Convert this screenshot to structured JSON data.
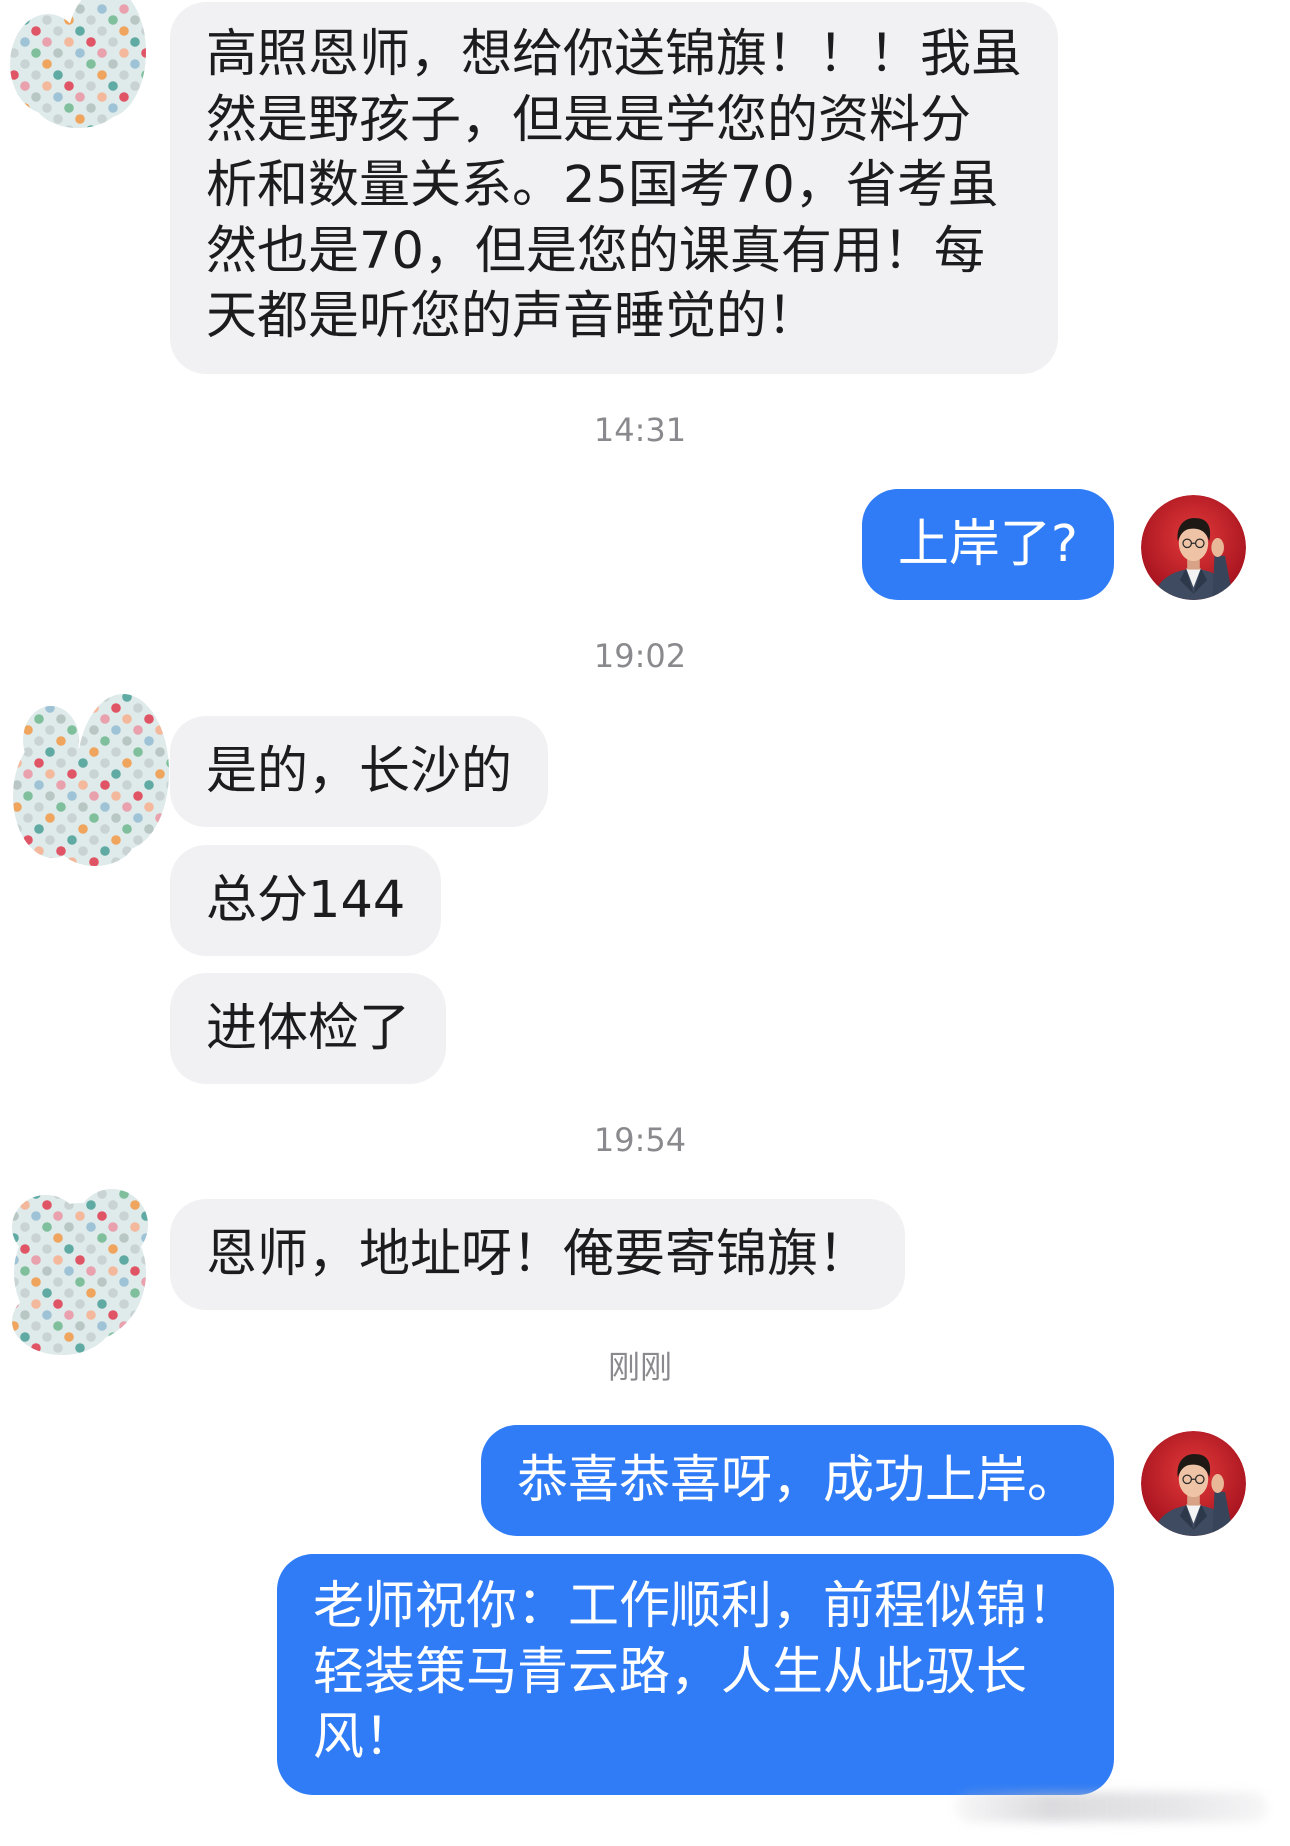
{
  "chat": {
    "timestamps": [
      "14:31",
      "19:02",
      "19:54",
      "刚刚"
    ],
    "incoming_messages": [
      {
        "lines": [
          "高照恩师，想给你送锦旗！！！我虽",
          "然是野孩子，但是是学您的资料分",
          "析和数量关系。25国考70，省考虽",
          "然也是70，但是您的课真有用！每",
          "天都是听您的声音睡觉的！"
        ]
      },
      {
        "lines": [
          "是的，长沙的"
        ]
      },
      {
        "lines": [
          "总分144"
        ]
      },
      {
        "lines": [
          "进体检了"
        ]
      },
      {
        "lines": [
          "恩师，地址呀！俺要寄锦旗！"
        ]
      }
    ],
    "outgoing_messages": [
      {
        "lines": [
          "上岸了?"
        ]
      },
      {
        "lines": [
          "恭喜恭喜呀，成功上岸。"
        ]
      },
      {
        "lines": [
          "老师祝你：工作顺利，前程似锦！",
          "轻装策马青云路，人生从此驭长",
          "风！"
        ]
      }
    ]
  },
  "icons": {
    "contact_avatar": "polka-dot-mask-icon",
    "user_avatar": "portrait-photo-icon"
  },
  "colors": {
    "page_background": "#ffffff",
    "incoming_bubble": "#f1f1f3",
    "incoming_text": "#1c1c1e",
    "outgoing_bubble": "#2f7cf6",
    "outgoing_text": "#ffffff",
    "timestamp_text": "#8a8a8e",
    "avatar_blob": "#dfeaea"
  },
  "avatar_dot_colors": [
    "#f0a55e",
    "#c9d3d3",
    "#e8a1ad",
    "#7fbf9c",
    "#c9d3d3",
    "#e05566",
    "#9fc3d6",
    "#c9d3d3",
    "#5faaa3",
    "#f4b89c",
    "#b9c7c4"
  ]
}
